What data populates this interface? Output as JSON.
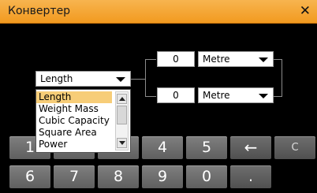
{
  "window": {
    "title": "Конвертер",
    "close_glyph": "✕"
  },
  "category": {
    "selected": "Length",
    "options": [
      "Length",
      "Weight Mass",
      "Cubic Capacity",
      "Square Area",
      "Power"
    ]
  },
  "converter": {
    "top": {
      "value": "0",
      "unit": "Metre"
    },
    "bottom": {
      "value": "0",
      "unit": "Metre"
    }
  },
  "keypad": {
    "row1": [
      "1",
      "2",
      "3",
      "4",
      "5",
      "←",
      "C"
    ],
    "row2": [
      "6",
      "7",
      "8",
      "9",
      "0",
      "."
    ]
  },
  "colors": {
    "titlebar": "#f29a1f",
    "selected_item": "#f7cd78",
    "key": "#6a6a6a"
  }
}
